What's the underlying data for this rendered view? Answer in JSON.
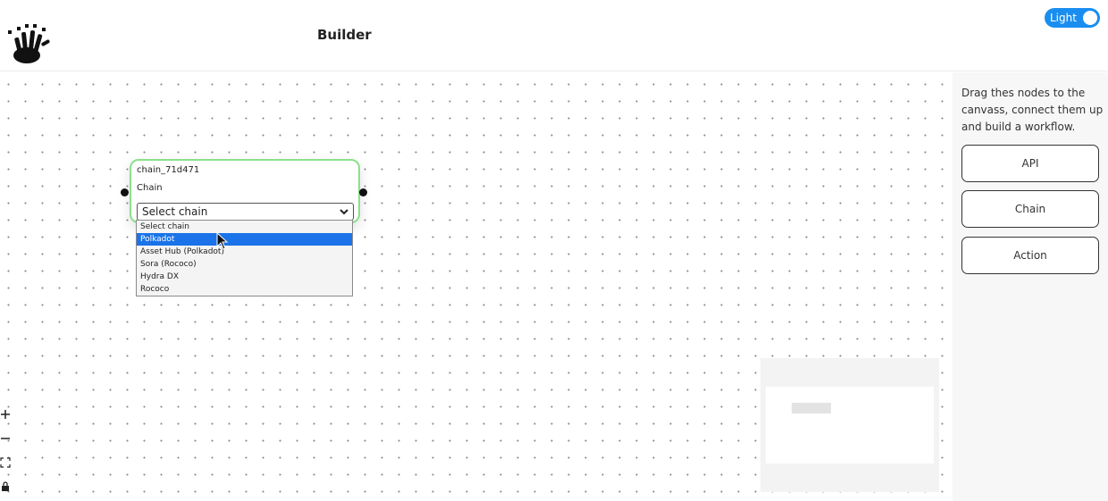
{
  "header": {
    "title": "Builder",
    "theme_toggle": {
      "label": "Light",
      "state": "on",
      "color": "#1a8ef0"
    },
    "logo_icon": "crown-hand-logo"
  },
  "canvas": {
    "node": {
      "id": "chain_71d471",
      "type": "Chain",
      "border_color": "#8be08a",
      "select": {
        "value": "Select chain",
        "options": [
          "Select chain",
          "Polkadot",
          "Asset Hub (Polkadot)",
          "Sora (Rococo)",
          "Hydra DX",
          "Rococo"
        ],
        "highlighted": "Polkadot"
      }
    },
    "controls": [
      {
        "name": "zoom-in-icon",
        "glyph": "+"
      },
      {
        "name": "zoom-out-icon",
        "glyph": "−"
      },
      {
        "name": "fit-view-icon",
        "glyph": "⛶"
      },
      {
        "name": "lock-icon",
        "glyph": "🔒"
      }
    ]
  },
  "sidebar": {
    "instructions": "Drag thes nodes to the canvass, connect them up and build a workflow.",
    "nodes": [
      "API",
      "Chain",
      "Action"
    ]
  }
}
